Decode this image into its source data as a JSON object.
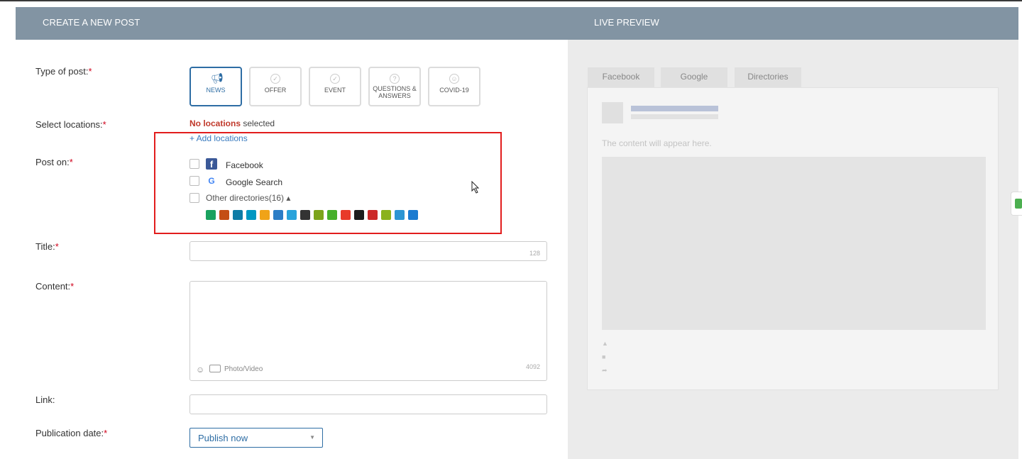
{
  "header": {
    "left_title": "CREATE A NEW POST",
    "right_title": "LIVE PREVIEW"
  },
  "form": {
    "type_label": "Type of post:",
    "required_mark": "*",
    "types": [
      {
        "label": "NEWS",
        "icon": "megaphone-icon",
        "active": true
      },
      {
        "label": "OFFER",
        "icon": "check-circle-icon",
        "active": false
      },
      {
        "label": "EVENT",
        "icon": "check-circle-icon",
        "active": false
      },
      {
        "label": "QUESTIONS & ANSWERS",
        "icon": "question-icon",
        "active": false
      },
      {
        "label": "COVID-19",
        "icon": "virus-icon",
        "active": false
      }
    ],
    "locations_label": "Select locations:",
    "locations_bold": "No locations",
    "locations_rest": " selected",
    "add_locations": "+ Add locations",
    "post_on_label": "Post on:",
    "post_on": [
      {
        "label": "Facebook",
        "icon": "facebook-icon"
      },
      {
        "label": "Google Search",
        "icon": "google-icon"
      },
      {
        "label": "Other directories(16) ▴",
        "icon": ""
      }
    ],
    "directory_colors": [
      "#1aa25f",
      "#c44e14",
      "#0e7ca6",
      "#0097c2",
      "#f0a318",
      "#2b7dc6",
      "#29a3db",
      "#333333",
      "#7ca41b",
      "#47b02b",
      "#e83a2a",
      "#1d1d1d",
      "#cc2a2a",
      "#8bb21e",
      "#2c95d3",
      "#1b7bd0"
    ],
    "title_label": "Title:",
    "title_counter": "128",
    "content_label": "Content:",
    "content_counter": "4092",
    "photo_video": "Photo/Video",
    "link_label": "Link:",
    "date_label": "Publication date:",
    "date_value": "Publish now"
  },
  "preview": {
    "tabs": [
      "Facebook",
      "Google",
      "Directories"
    ],
    "placeholder": "The content will appear here."
  },
  "colors": {
    "header_bg": "#8294a3",
    "accent": "#2e6da4",
    "required": "#d0021b",
    "highlight_box": "#e21d1d"
  }
}
